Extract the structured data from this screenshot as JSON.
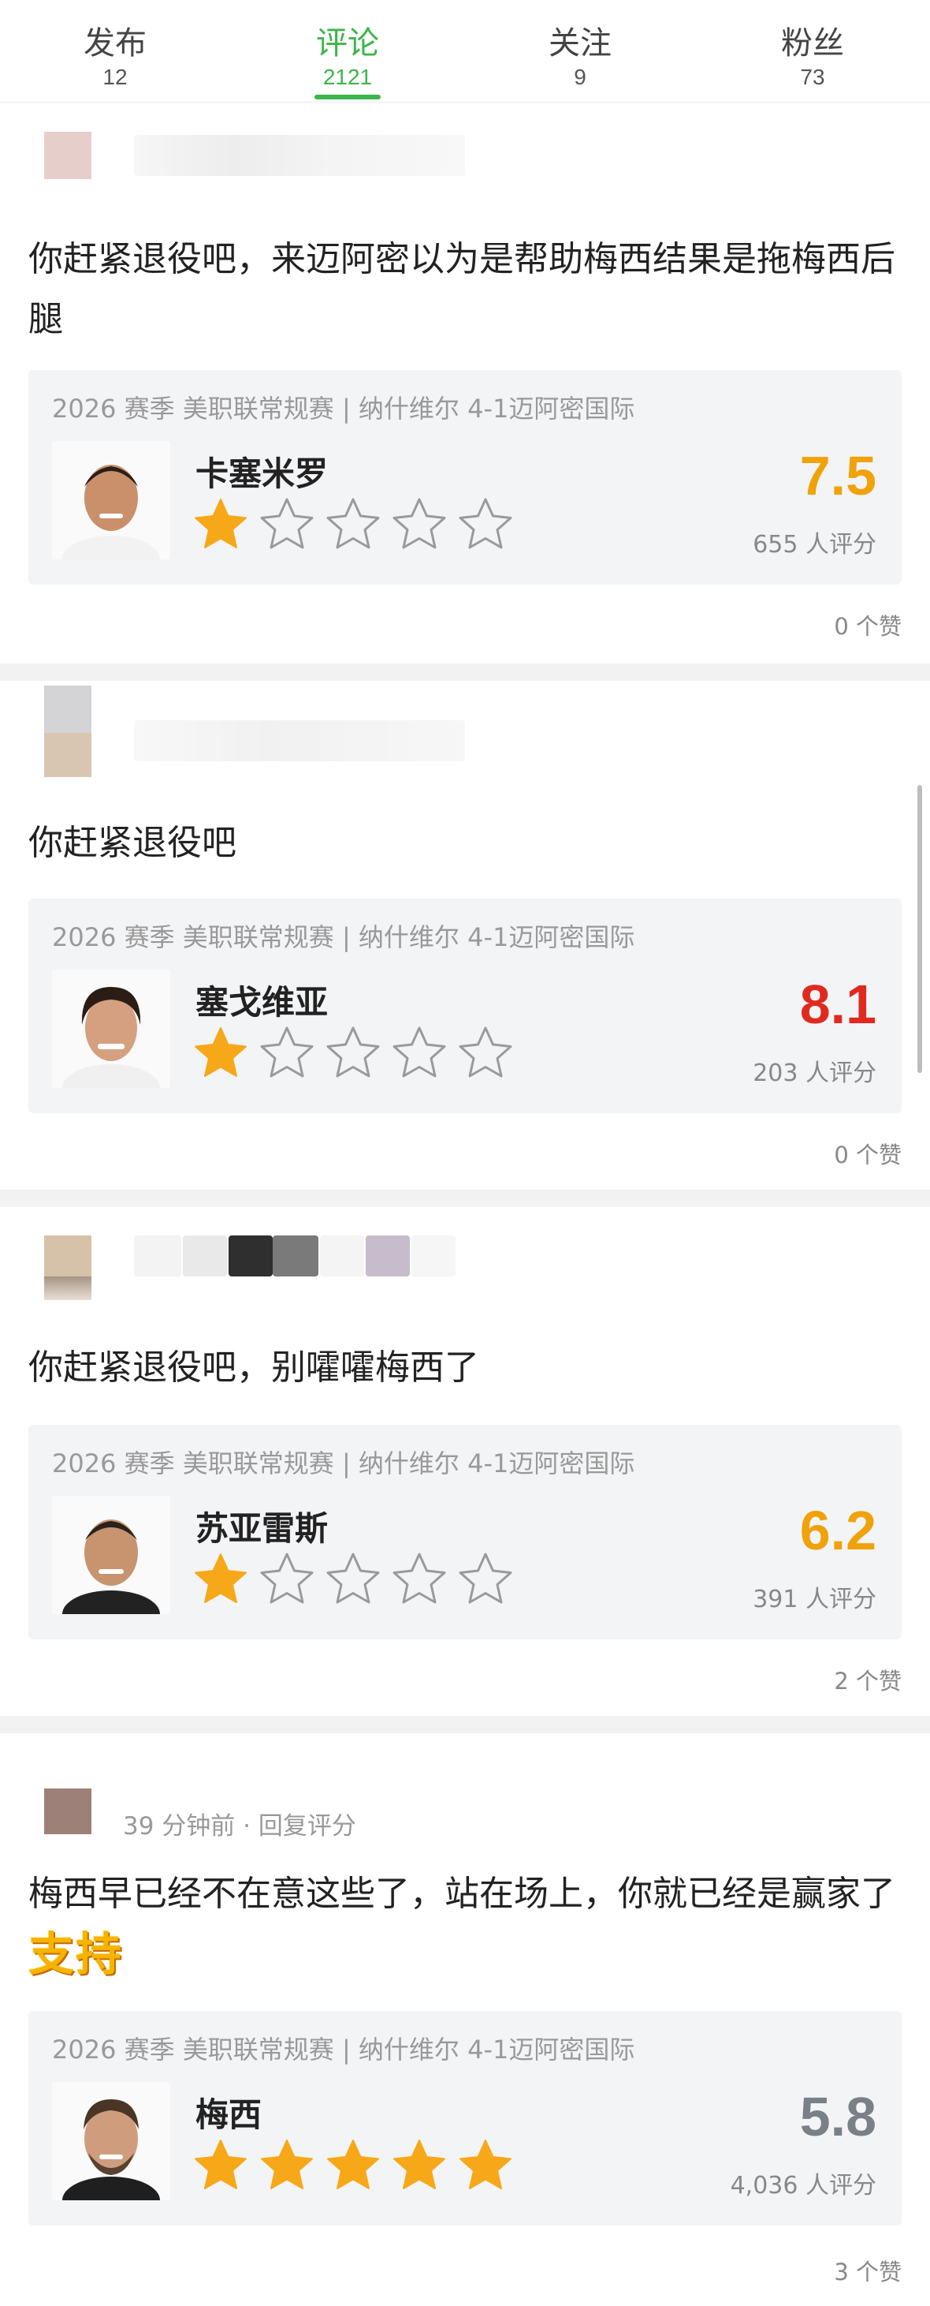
{
  "tabs": [
    {
      "label": "发布",
      "count": "12"
    },
    {
      "label": "评论",
      "count": "2121"
    },
    {
      "label": "关注",
      "count": "9"
    },
    {
      "label": "粉丝",
      "count": "73"
    }
  ],
  "active_tab_index": 1,
  "colors": {
    "accent_green": "#3cb54a",
    "star_filled": "#f6a818",
    "star_empty": "#9a9a9a",
    "score_orange": "#f0a20a",
    "score_red": "#e02a20",
    "score_gray": "#7a8088"
  },
  "comments": [
    {
      "meta": "",
      "text": "你赶紧退役吧，来迈阿密以为是帮助梅西结果是拖梅西后腿",
      "sticker": "",
      "match": "2026 赛季 美职联常规赛 | 纳什维尔 4-1迈阿密国际",
      "player": "卡塞米罗",
      "stars_filled": 1,
      "score": "7.5",
      "score_color": "#f0a20a",
      "raters": "655 人评分",
      "likes": "0 个赞"
    },
    {
      "meta": "",
      "text": "你赶紧退役吧",
      "sticker": "",
      "match": "2026 赛季 美职联常规赛 | 纳什维尔 4-1迈阿密国际",
      "player": "塞戈维亚",
      "stars_filled": 1,
      "score": "8.1",
      "score_color": "#e02a20",
      "raters": "203 人评分",
      "likes": "0 个赞"
    },
    {
      "meta": "",
      "text": "你赶紧退役吧，别嚯嚯梅西了",
      "sticker": "",
      "match": "2026 赛季 美职联常规赛 | 纳什维尔 4-1迈阿密国际",
      "player": "苏亚雷斯",
      "stars_filled": 1,
      "score": "6.2",
      "score_color": "#f0a20a",
      "raters": "391 人评分",
      "likes": "2 个赞"
    },
    {
      "meta": "39 分钟前 · 回复评分",
      "text": "梅西早已经不在意这些了，站在场上，你就已经是赢家了",
      "sticker": "支持",
      "match": "2026 赛季 美职联常规赛 | 纳什维尔 4-1迈阿密国际",
      "player": "梅西",
      "stars_filled": 5,
      "score": "5.8",
      "score_color": "#7a8088",
      "raters": "4,036 人评分",
      "likes": "3 个赞"
    }
  ]
}
